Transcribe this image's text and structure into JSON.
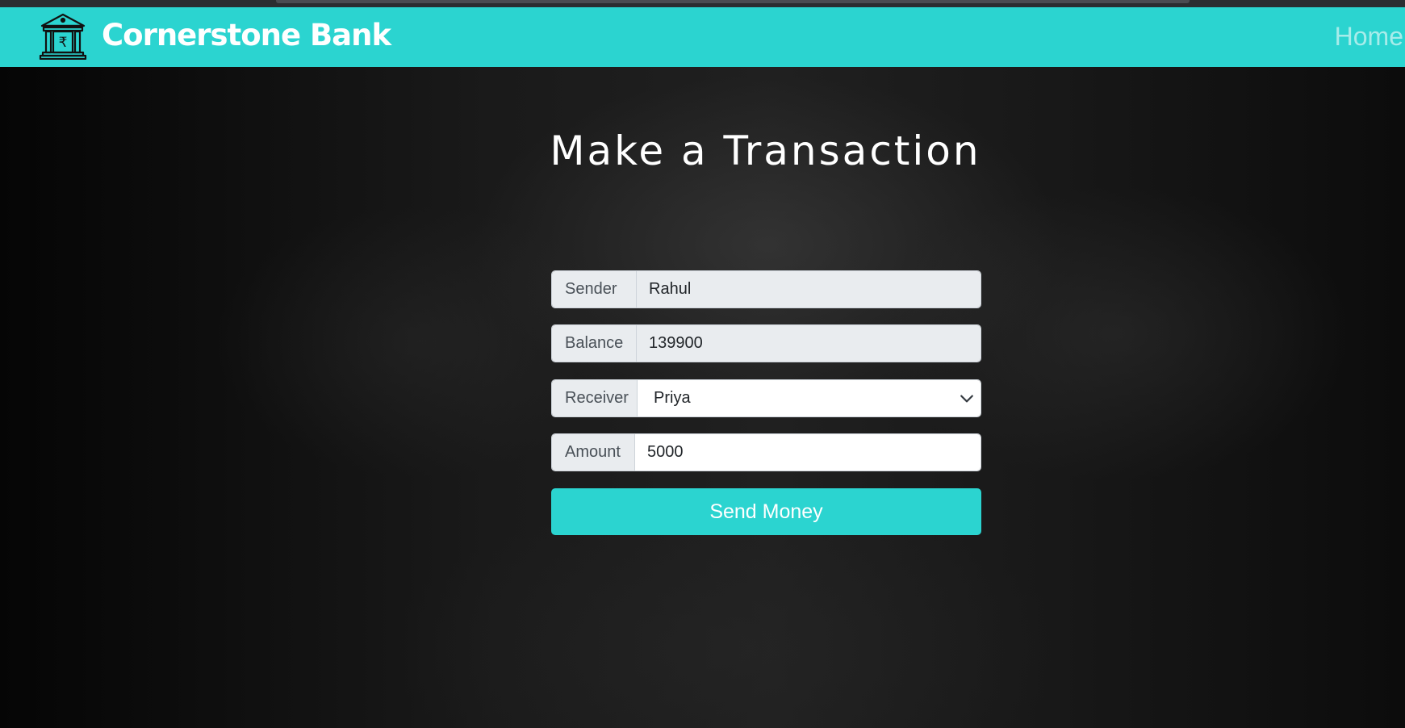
{
  "colors": {
    "brand_accent": "#2bd4d0",
    "background": "#121212",
    "nav_link": "#a7ecea"
  },
  "navbar": {
    "brand_name": "Cornerstone Bank",
    "logo_icon": "bank-building-rupee-icon",
    "home_link": "Home"
  },
  "page": {
    "title": "Make a Transaction"
  },
  "form": {
    "sender": {
      "label": "Sender",
      "value": "Rahul"
    },
    "balance": {
      "label": "Balance",
      "value": "139900"
    },
    "receiver": {
      "label": "Receiver",
      "selected": "Priya",
      "icon": "chevron-down-icon"
    },
    "amount": {
      "label": "Amount",
      "value": "5000"
    },
    "submit_label": "Send Money"
  }
}
